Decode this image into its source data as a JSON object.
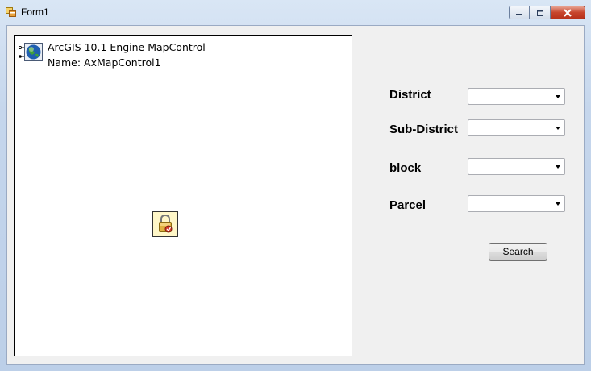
{
  "window": {
    "title": "Form1",
    "icon": "form-app-icon",
    "caption_buttons": [
      "minimize-icon",
      "maximize-icon",
      "close-icon"
    ]
  },
  "map_control": {
    "line1": "ArcGIS 10.1 Engine MapControl",
    "line2": "Name: AxMapControl1",
    "icons": [
      "globe-icon",
      "license-lock-icon"
    ]
  },
  "form": {
    "district_label": "District",
    "subdistrict_label": "Sub-District",
    "block_label": "block",
    "parcel_label": "Parcel",
    "district_value": "",
    "subdistrict_value": "",
    "block_value": "",
    "parcel_value": "",
    "search_label": "Search"
  }
}
